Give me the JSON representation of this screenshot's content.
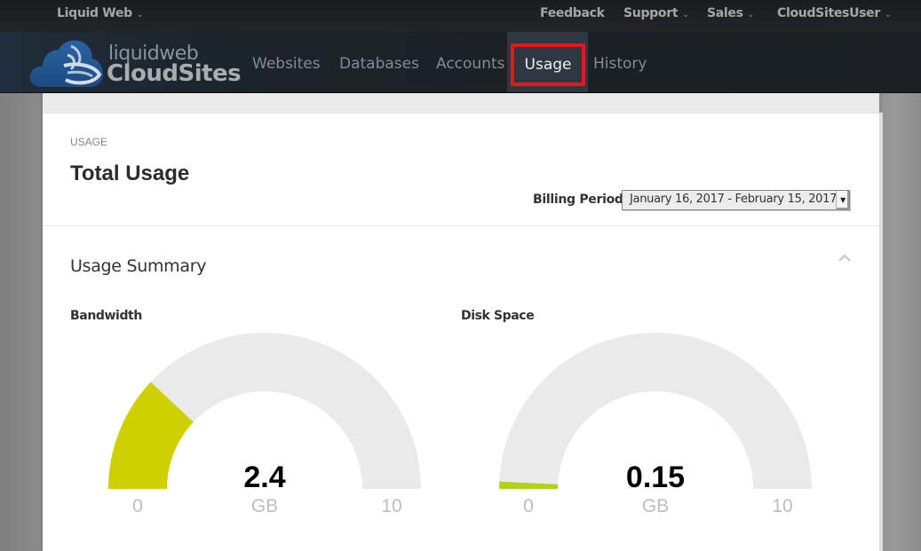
{
  "topbar": {
    "brand_menu": "Liquid Web",
    "links": [
      {
        "label": "Feedback",
        "dropdown": false
      },
      {
        "label": "Support",
        "dropdown": true
      },
      {
        "label": "Sales",
        "dropdown": true
      },
      {
        "label": "CloudSitesUser",
        "dropdown": true
      }
    ]
  },
  "logo": {
    "line1": "liquidweb",
    "line2": "CloudSites"
  },
  "nav": {
    "items": [
      {
        "label": "Websites",
        "active": false
      },
      {
        "label": "Databases",
        "active": false
      },
      {
        "label": "Accounts",
        "active": false
      },
      {
        "label": "Usage",
        "active": true
      },
      {
        "label": "History",
        "active": false
      }
    ],
    "highlight_color": "#e5161c"
  },
  "page": {
    "breadcrumb": "USAGE",
    "title": "Total Usage",
    "billing_period_label": "Billing Period:",
    "billing_period_value": "January 16, 2017 - February 15, 2017"
  },
  "summary": {
    "title": "Usage Summary",
    "collapse_icon": "chevron-up-icon"
  },
  "chart_data": [
    {
      "type": "gauge",
      "title": "Bandwidth",
      "value": 2.4,
      "display_value": "2.4",
      "unit": "GB",
      "min": 0,
      "max": 10,
      "min_label": "0",
      "max_label": "10",
      "fill_color": "#cfd000",
      "track_color": "#ebeaeb"
    },
    {
      "type": "gauge",
      "title": "Disk Space",
      "value": 0.15,
      "display_value": "0.15",
      "unit": "GB",
      "min": 0,
      "max": 10,
      "min_label": "0",
      "max_label": "10",
      "fill_color": "#aed418",
      "track_color": "#ebeaeb"
    }
  ]
}
